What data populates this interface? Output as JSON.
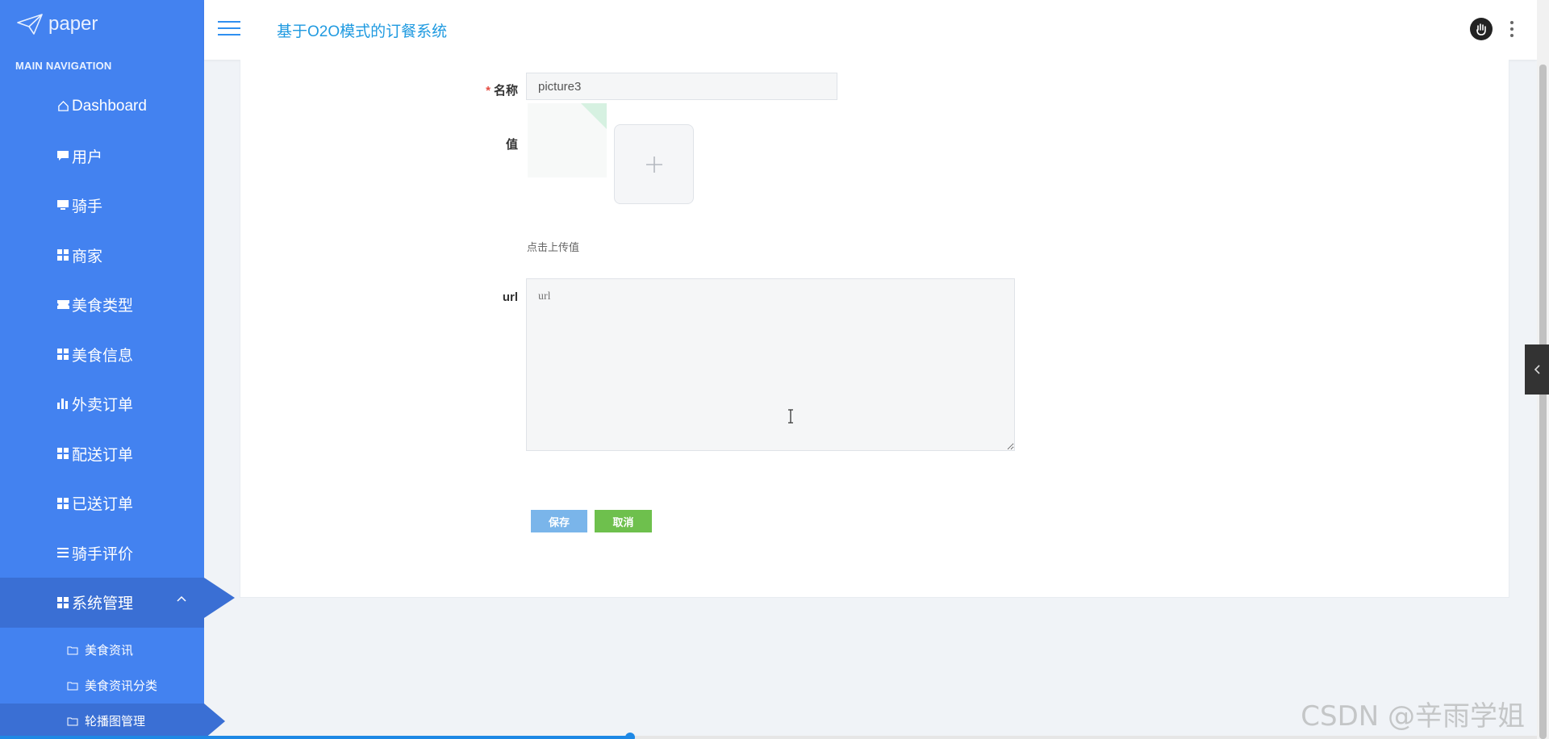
{
  "brand": {
    "name": "paper"
  },
  "sidebar": {
    "heading": "MAIN NAVIGATION",
    "items": [
      {
        "label": "Dashboard",
        "icon": "home-icon"
      },
      {
        "label": "用户",
        "icon": "chat-icon"
      },
      {
        "label": "骑手",
        "icon": "monitor-icon"
      },
      {
        "label": "商家",
        "icon": "grid-icon"
      },
      {
        "label": "美食类型",
        "icon": "ticket-icon"
      },
      {
        "label": "美食信息",
        "icon": "grid-icon"
      },
      {
        "label": "外卖订单",
        "icon": "bar-chart-icon"
      },
      {
        "label": "配送订单",
        "icon": "grid-icon"
      },
      {
        "label": "已送订单",
        "icon": "grid-icon"
      },
      {
        "label": "骑手评价",
        "icon": "list-icon"
      },
      {
        "label": "系统管理",
        "icon": "grid-icon",
        "active": true,
        "expanded": true
      }
    ],
    "sub_items": [
      {
        "label": "美食资讯",
        "icon": "folder-icon"
      },
      {
        "label": "美食资讯分类",
        "icon": "folder-icon"
      },
      {
        "label": "轮播图管理",
        "icon": "folder-icon",
        "active": true
      }
    ]
  },
  "header": {
    "title": "基于O2O模式的订餐系统"
  },
  "form": {
    "name_label": "名称",
    "name_required_mark": "*",
    "name_value": "picture3",
    "value_label": "值",
    "upload_hint": "点击上传值",
    "url_label": "url",
    "url_placeholder": "url",
    "save_label": "保存",
    "cancel_label": "取消"
  },
  "progress": {
    "fraction": 0.41
  },
  "watermark": "CSDN @辛雨学姐",
  "colors": {
    "sidebar": "#4382f0",
    "sidebar_active": "#3a6fd4",
    "title": "#1f9ae0",
    "save": "#7ab5ea",
    "cancel": "#6ec04d"
  }
}
